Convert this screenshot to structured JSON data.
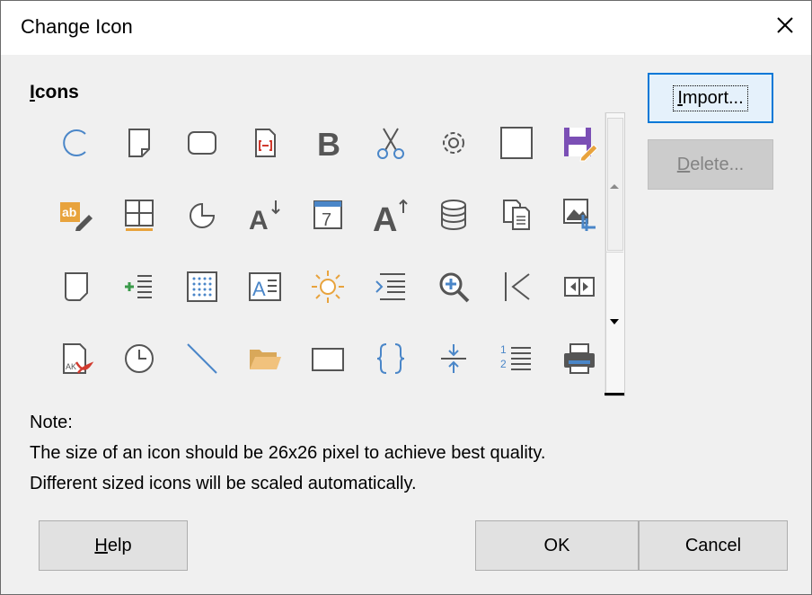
{
  "window": {
    "title": "Change Icon"
  },
  "icons_section": {
    "label_accel": "I",
    "label_rest": "cons"
  },
  "buttons": {
    "import": {
      "accel": "I",
      "rest": "mport..."
    },
    "delete": {
      "accel": "D",
      "rest": "elete..."
    },
    "help": {
      "accel": "H",
      "rest": "elp"
    },
    "ok": "OK",
    "cancel": "Cancel"
  },
  "note": {
    "heading": "Note:",
    "line1": "The size of an icon should be 26x26 pixel to achieve best quality.",
    "line2": "Different sized icons will be scaled automatically."
  },
  "icon_grid": [
    [
      "arc-icon",
      "page-icon",
      "rounded-rect-icon",
      "field-doc-icon",
      "bold-icon",
      "cut-icon",
      "settings-gear-icon",
      "rectangle-icon",
      "save-as-icon"
    ],
    [
      "edit-text-icon",
      "table-icon",
      "pie-icon",
      "font-size-decrease-icon",
      "calendar-date-icon",
      "font-size-increase-icon",
      "database-icon",
      "copy-icon",
      "crop-image-icon"
    ],
    [
      "callout-icon",
      "insert-rows-icon",
      "grid-points-icon",
      "text-frame-icon",
      "sun-icon",
      "increase-indent-icon",
      "zoom-in-icon",
      "first-record-icon",
      "split-view-icon"
    ],
    [
      "export-pdf-icon",
      "clock-icon",
      "line-icon",
      "open-folder-icon",
      "frame-icon",
      "braces-icon",
      "decrease-spacing-icon",
      "numbered-list-icon",
      "print-icon"
    ]
  ],
  "colors": {
    "accent_blue": "#4a86c8",
    "focus_border": "#0078d7",
    "dialog_bg": "#f0f0f0",
    "purple": "#7b4fb5",
    "orange": "#e8a33d",
    "red": "#d13b2f"
  }
}
